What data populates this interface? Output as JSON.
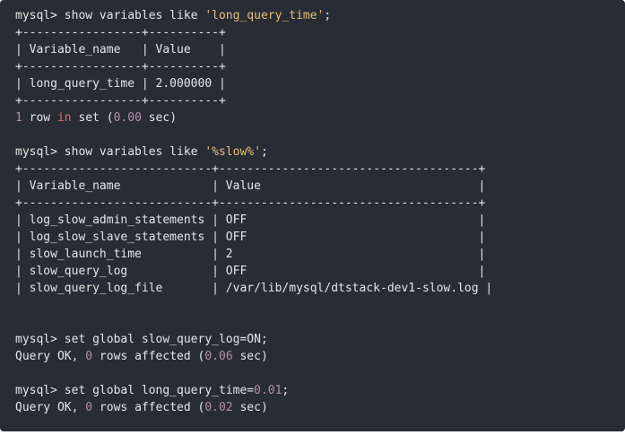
{
  "colors": {
    "background": "#282c34",
    "text": "#e6e6e6",
    "string": "#e5c07b",
    "number": "#b48ead",
    "keyword": "#e06c75"
  },
  "lines": [
    [
      {
        "t": "mysql> show variables like ",
        "k": "plain"
      },
      {
        "t": "'long_query_time'",
        "k": "string"
      },
      {
        "t": ";",
        "k": "plain"
      }
    ],
    [
      {
        "t": "+-----------------+----------+",
        "k": "plain"
      }
    ],
    [
      {
        "t": "| Variable_name   | Value    |",
        "k": "plain"
      }
    ],
    [
      {
        "t": "+-----------------+----------+",
        "k": "plain"
      }
    ],
    [
      {
        "t": "| long_query_time | 2.000000 |",
        "k": "plain"
      }
    ],
    [
      {
        "t": "+-----------------+----------+",
        "k": "plain"
      }
    ],
    [
      {
        "t": "1",
        "k": "number"
      },
      {
        "t": " row ",
        "k": "plain"
      },
      {
        "t": "in",
        "k": "keyword"
      },
      {
        "t": " set (",
        "k": "plain"
      },
      {
        "t": "0.00",
        "k": "number"
      },
      {
        "t": " sec)",
        "k": "plain"
      }
    ],
    [],
    [
      {
        "t": "mysql> show variables like ",
        "k": "plain"
      },
      {
        "t": "'%slow%'",
        "k": "string"
      },
      {
        "t": ";",
        "k": "plain"
      }
    ],
    [
      {
        "t": "+---------------------------+-------------------------------------+",
        "k": "plain"
      }
    ],
    [
      {
        "t": "| Variable_name             | Value                               |",
        "k": "plain"
      }
    ],
    [
      {
        "t": "+---------------------------+-------------------------------------+",
        "k": "plain"
      }
    ],
    [
      {
        "t": "| log_slow_admin_statements | OFF                                 |",
        "k": "plain"
      }
    ],
    [
      {
        "t": "| log_slow_slave_statements | OFF                                 |",
        "k": "plain"
      }
    ],
    [
      {
        "t": "| slow_launch_time          | 2                                   |",
        "k": "plain"
      }
    ],
    [
      {
        "t": "| slow_query_log            | OFF                                 |",
        "k": "plain"
      }
    ],
    [
      {
        "t": "| slow_query_log_file       | /var/lib/mysql/dtstack-dev1-slow.log |",
        "k": "plain"
      }
    ],
    [],
    [],
    [
      {
        "t": "mysql> set global slow_query_log=ON;",
        "k": "plain"
      }
    ],
    [
      {
        "t": "Query OK, ",
        "k": "plain"
      },
      {
        "t": "0",
        "k": "number"
      },
      {
        "t": " rows affected (",
        "k": "plain"
      },
      {
        "t": "0.06",
        "k": "number"
      },
      {
        "t": " sec)",
        "k": "plain"
      }
    ],
    [],
    [
      {
        "t": "mysql> set global long_query_time=",
        "k": "plain"
      },
      {
        "t": "0.01",
        "k": "number"
      },
      {
        "t": ";",
        "k": "plain"
      }
    ],
    [
      {
        "t": "Query OK, ",
        "k": "plain"
      },
      {
        "t": "0",
        "k": "number"
      },
      {
        "t": " rows affected (",
        "k": "plain"
      },
      {
        "t": "0.02",
        "k": "number"
      },
      {
        "t": " sec)",
        "k": "plain"
      }
    ]
  ]
}
